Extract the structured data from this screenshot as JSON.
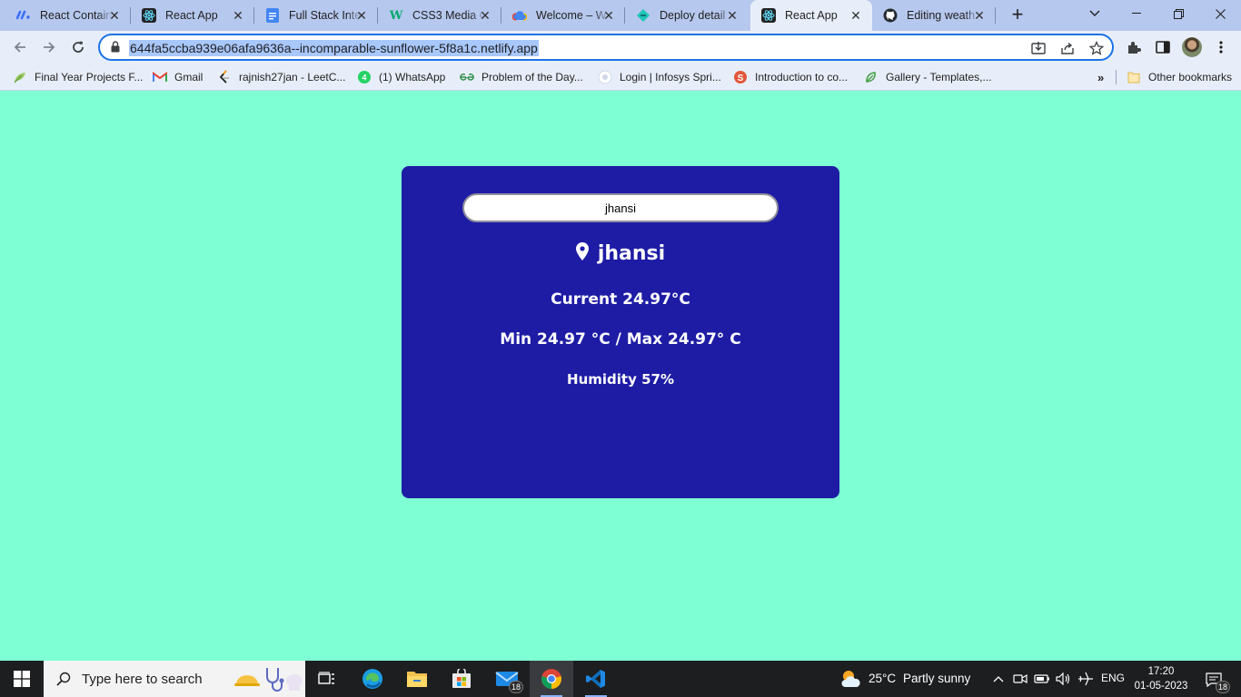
{
  "browser": {
    "tabs": [
      {
        "title": "React Contain",
        "icon": "monday-icon",
        "active": false
      },
      {
        "title": "React App",
        "icon": "react-icon",
        "active": false
      },
      {
        "title": "Full Stack Inte",
        "icon": "google-docs-icon",
        "active": false
      },
      {
        "title": "CSS3 Media C",
        "icon": "w3schools-icon",
        "active": false
      },
      {
        "title": "Welcome – W",
        "icon": "cloud-icon",
        "active": false
      },
      {
        "title": "Deploy detail",
        "icon": "netlify-icon",
        "active": false
      },
      {
        "title": "React App",
        "icon": "react-icon",
        "active": true
      },
      {
        "title": "Editing weath",
        "icon": "github-icon",
        "active": false
      }
    ],
    "url": "644fa5ccba939e06afa9636a--incomparable-sunflower-5f8a1c.netlify.app",
    "bookmarks": [
      {
        "label": "Final Year Projects F...",
        "icon": "leaf-icon"
      },
      {
        "label": "Gmail",
        "icon": "gmail-icon"
      },
      {
        "label": "rajnish27jan - LeetC...",
        "icon": "leetcode-icon"
      },
      {
        "label": "(1) WhatsApp",
        "icon": "whatsapp-icon"
      },
      {
        "label": "Problem of the Day...",
        "icon": "geeksforgeeks-icon"
      },
      {
        "label": "Login | Infosys Spri...",
        "icon": "infosys-icon"
      },
      {
        "label": "Introduction to co...",
        "icon": "stepik-icon"
      },
      {
        "label": "Gallery - Templates,...",
        "icon": "gallery-icon"
      }
    ],
    "other_bookmarks": "Other bookmarks",
    "more_bookmarks": "»"
  },
  "weather": {
    "search_value": "jhansi",
    "city": "jhansi",
    "current": "Current 24.97°C",
    "minmax": "Min 24.97 °C / Max 24.97° C",
    "humidity": "Humidity 57%"
  },
  "taskbar": {
    "search_placeholder": "Type here to search",
    "mail_badge": "18",
    "weather": {
      "temp": "25°C",
      "condition": "Partly sunny"
    },
    "language": "ENG",
    "time": "17:20",
    "date": "01-05-2023",
    "notif_badge": "18"
  },
  "colors": {
    "page_bg": "#7fffd4",
    "card_bg": "#1e1ca5",
    "tab_strip": "#b6c8ee",
    "toolbar": "#e8eef9",
    "taskbar": "#1d1e20"
  }
}
